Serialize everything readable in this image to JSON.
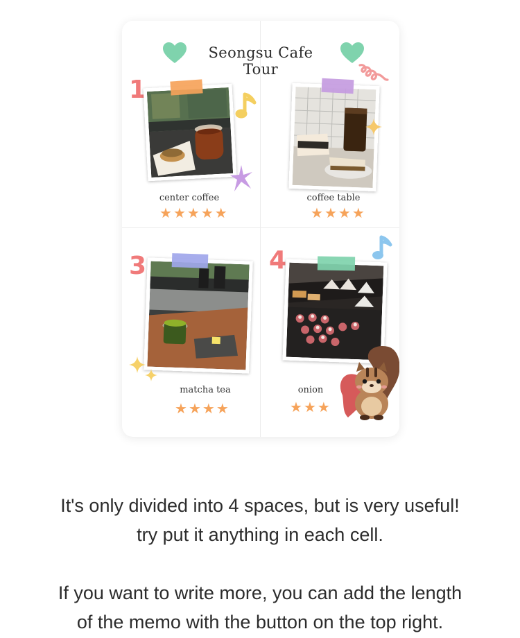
{
  "memo": {
    "title": "Seongsu Cafe Tour",
    "cells": [
      {
        "number": "1",
        "name": "center coffee",
        "rating": 5,
        "number_color": "#f07a7a",
        "tape_color": "#f6a35a"
      },
      {
        "number": "",
        "name": "coffee table",
        "rating": 4,
        "number_color": "#f07a7a",
        "tape_color": "#c49be0"
      },
      {
        "number": "3",
        "name": "matcha tea",
        "rating": 4,
        "number_color": "#f07a7a",
        "tape_color": "#9fa6ea"
      },
      {
        "number": "4",
        "name": "onion",
        "rating": 3,
        "number_color": "#f07a7a",
        "tape_color": "#7fd3ad"
      }
    ],
    "star_color": "#f6a35a",
    "heart_color": "#7fd3ad"
  },
  "caption": {
    "line1": "It's only divided into 4 spaces, but is very useful!",
    "line2": "try put it anything in each cell.",
    "line3": "If you want to write more, you can add the length",
    "line4": "of the memo with the button on the top right."
  },
  "icons": [
    "heart-icon",
    "music-note-icon",
    "sparkle-icon",
    "star-burst-icon",
    "swirl-icon",
    "squirrel-sticker",
    "star-icon"
  ]
}
